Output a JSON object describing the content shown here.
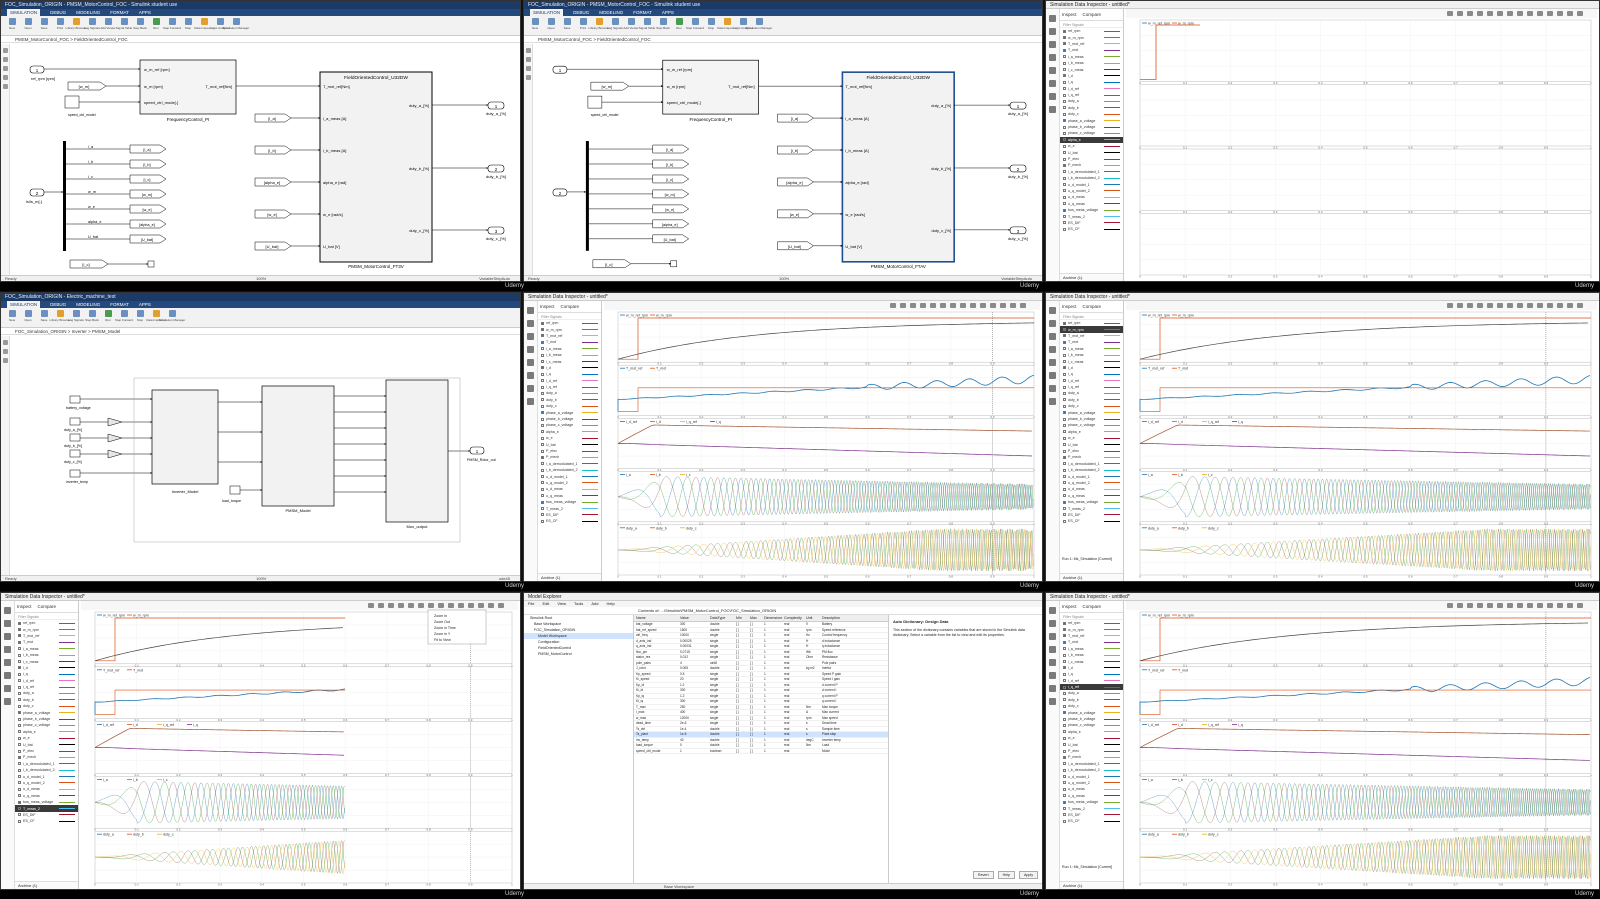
{
  "watermark": "Udemy",
  "simulink_fotw": {
    "title": "FOC_Simulation_ORIGIN - PMSM_MotorControl_FOC - Simulink student use",
    "tabs": [
      "SIMULATION",
      "DEBUG",
      "MODELING",
      "FORMAT",
      "APPS"
    ],
    "ribbon": [
      "New",
      "Open",
      "Save",
      "Print",
      "Library Browser",
      "Log Signals",
      "Add Viewer",
      "Signal Table",
      "Step Back",
      "Run",
      "Step Forward",
      "Stop",
      "Data Inspector",
      "Logic Analyzer",
      "Simulation Manager"
    ],
    "address": "PMSM_MotorControl_FOC > FieldOrientedControl_FOC",
    "blocks": {
      "freq_ctrl": "FrequencyControl_PI",
      "foc": "FieldOrientedControl_U32DW",
      "pmsm": "PMSM_MotorControl_FT3V",
      "pmsm_right": "PMSM_MotorControl_FTAV",
      "speed_ctrl": "speed_ctrl_model"
    },
    "in_ports": [
      "ref_rpm [rpm]",
      "ls/ls_m[-]"
    ],
    "freq_ports_in": [
      "w_m_ref [rpm]",
      "w_m [rpm]",
      "speed_ctrl_mode[-]"
    ],
    "freq_ports_out": "T_mot_ref[Nm]",
    "foc_ports_in": [
      "T_mot_ref[Nm]",
      "i_a_meas [A]",
      "i_b_meas [A]",
      "alpha_e [rad]",
      "w_e [rad/s]",
      "U_bat [V]"
    ],
    "foc_ports_out": [
      "duty_a_[%]",
      "duty_b_[%]",
      "duty_c_[%]"
    ],
    "out_ports": [
      "duty_a_[%]",
      "duty_b_[%]",
      "duty_c_[%]"
    ],
    "goto_tags": [
      "[i_a]",
      "[i_b]",
      "[alpha_e]",
      "[w_e]",
      "[U_bat]"
    ],
    "mux_tags": [
      "[i_a]",
      "[i_b]",
      "[i_c]",
      "[w_m]",
      "[w_e]",
      "[alpha_e]",
      "[U_bat]"
    ],
    "mux_labels": [
      "i_a",
      "i_b",
      "i_c",
      "w_m",
      "w_e",
      "alpha_e",
      "U_bat"
    ],
    "from_tag": "[i_c]",
    "status_left": "Ready",
    "status_mid": "100%",
    "status_right": "VariableStepAuto"
  },
  "simulink_plant": {
    "title": "FOC_Simulation_ORIGIN - Electric_machine_test",
    "address": "FOC_Simulation_ORIGIN > Inverter > PMSM_Model",
    "blocks": [
      "Inverter_Model",
      "PMSM_Model",
      "Mux_output"
    ],
    "inputs": [
      "battery_voltage",
      "duty_a_[%]",
      "duty_b_[%]",
      "duty_c_[%]",
      "inverter_temp"
    ],
    "load_torque": "load_torque",
    "pmsm_out_port": "PMSM_Rotor_out",
    "status_mid": "100%",
    "status_right": "ode45"
  },
  "data_inspector": {
    "title": "Simulation Data Inspector - untitled*",
    "tabs": [
      "Inspect",
      "Compare"
    ],
    "filter": "Filter Signals",
    "signals": [
      "ref_rpm",
      "w_m_rpm",
      "T_mot_ref",
      "T_mot",
      "i_a_meas",
      "i_b_meas",
      "i_c_meas",
      "i_d",
      "i_q",
      "i_d_ref",
      "i_q_ref",
      "duty_a",
      "duty_b",
      "duty_c",
      "phase_a_voltage",
      "phase_b_voltage",
      "phase_c_voltage",
      "alpha_e",
      "w_e",
      "U_bat",
      "P_elec",
      "P_mech",
      "i_a_demodulated_1",
      "i_b_demodulated_2",
      "u_d_model_1",
      "u_q_model_2",
      "u_d_meas",
      "u_q_meas",
      "bus_meas_voltage",
      "T_meas_2",
      "ES_DIF",
      "ES_CF"
    ],
    "footer": "Archive (1)",
    "properties": "Properties",
    "run_label": "Run 1: Mk_Simulation [Current]",
    "plot_titles": [
      [
        "w_m_ref_rpm",
        "w_m_rpm"
      ],
      [
        "T_mot_ref",
        "T_mot"
      ],
      [
        "i_d_ref",
        "i_d",
        "i_q_ref",
        "i_q"
      ],
      [
        "i_a",
        "i_b",
        "i_c"
      ],
      [
        "duty_a",
        "duty_b",
        "duty_c"
      ]
    ],
    "time_ticks": [
      "0",
      "0.1",
      "0.2",
      "0.3",
      "0.4",
      "0.5",
      "0.6",
      "0.7",
      "0.8",
      "0.9",
      "1"
    ],
    "menu_items": [
      "Zoom In",
      "Zoom Out",
      "Zoom in Time",
      "Zoom in Y",
      "Fit to View"
    ]
  },
  "model_explorer": {
    "title": "Model Explorer",
    "menu": [
      "File",
      "Edit",
      "View",
      "Tools",
      "Add",
      "Help"
    ],
    "path": "Contents of: ...\\Simulink\\PMSM_MotorControl_FOC\\FOC_Simulation_ORIGIN",
    "tree": [
      "Simulink Root",
      "Base Workspace",
      "FOC_Simulation_ORIGIN",
      "Model Workspace",
      "Configuration",
      "FieldOrientedControl",
      "PMSM_MotorControl"
    ],
    "columns": [
      "Name",
      "Value",
      "DataType",
      "Min",
      "Max",
      "Dimensions",
      "Complexity",
      "Unit",
      "Description"
    ],
    "rows": [
      [
        "bat_voltage",
        "300",
        "double",
        "[ ]",
        "[ ]",
        "1",
        "real",
        "V",
        "Battery"
      ],
      [
        "bat_ref_speed",
        "1500",
        "double",
        "[ ]",
        "[ ]",
        "1",
        "real",
        "rpm",
        "Speed reference"
      ],
      [
        "ctrl_freq",
        "10000",
        "single",
        "[ ]",
        "[ ]",
        "1",
        "real",
        "Hz",
        "Control frequency"
      ],
      [
        "d_axis_ind",
        "0.00025",
        "single",
        "[ ]",
        "[ ]",
        "1",
        "real",
        "H",
        "d inductance"
      ],
      [
        "q_axis_ind",
        "0.00031",
        "single",
        "[ ]",
        "[ ]",
        "1",
        "real",
        "H",
        "q inductance"
      ],
      [
        "flux_pm",
        "0.0715",
        "single",
        "[ ]",
        "[ ]",
        "1",
        "real",
        "Wb",
        "PM flux"
      ],
      [
        "stator_res",
        "0.012",
        "single",
        "[ ]",
        "[ ]",
        "1",
        "real",
        "Ohm",
        "Resistance"
      ],
      [
        "pole_pairs",
        "4",
        "uint8",
        "[ ]",
        "[ ]",
        "1",
        "real",
        "",
        "Pole pairs"
      ],
      [
        "J_rotor",
        "0.005",
        "double",
        "[ ]",
        "[ ]",
        "1",
        "real",
        "kg m2",
        "Inertia"
      ],
      [
        "Kp_speed",
        "0.5",
        "single",
        "[ ]",
        "[ ]",
        "1",
        "real",
        "",
        "Speed P gain"
      ],
      [
        "Ki_speed",
        "20",
        "single",
        "[ ]",
        "[ ]",
        "1",
        "real",
        "",
        "Speed I gain"
      ],
      [
        "Kp_id",
        "1.2",
        "single",
        "[ ]",
        "[ ]",
        "1",
        "real",
        "",
        "d current P"
      ],
      [
        "Ki_id",
        "300",
        "single",
        "[ ]",
        "[ ]",
        "1",
        "real",
        "",
        "d current I"
      ],
      [
        "Kp_iq",
        "1.2",
        "single",
        "[ ]",
        "[ ]",
        "1",
        "real",
        "",
        "q current P"
      ],
      [
        "Ki_iq",
        "300",
        "single",
        "[ ]",
        "[ ]",
        "1",
        "real",
        "",
        "q current I"
      ],
      [
        "T_max",
        "250",
        "single",
        "[ ]",
        "[ ]",
        "1",
        "real",
        "Nm",
        "Max torque"
      ],
      [
        "i_max",
        "400",
        "single",
        "[ ]",
        "[ ]",
        "1",
        "real",
        "A",
        "Max current"
      ],
      [
        "w_max",
        "12000",
        "single",
        "[ ]",
        "[ ]",
        "1",
        "real",
        "rpm",
        "Max speed"
      ],
      [
        "dead_time",
        "2e-6",
        "single",
        "[ ]",
        "[ ]",
        "1",
        "real",
        "s",
        "Dead time"
      ],
      [
        "Ts_ctrl",
        "1e-4",
        "double",
        "[ ]",
        "[ ]",
        "1",
        "real",
        "s",
        "Sample time"
      ],
      [
        "Ts_plant",
        "1e-6",
        "double",
        "[ ]",
        "[ ]",
        "1",
        "real",
        "s",
        "Plant step"
      ],
      [
        "inv_temp",
        "40",
        "double",
        "[ ]",
        "[ ]",
        "1",
        "real",
        "degC",
        "Inverter temp"
      ],
      [
        "load_torque",
        "0",
        "double",
        "[ ]",
        "[ ]",
        "1",
        "real",
        "Nm",
        "Load"
      ],
      [
        "speed_ctrl_mode",
        "1",
        "boolean",
        "[ ]",
        "[ ]",
        "1",
        "real",
        "",
        "Mode"
      ]
    ],
    "pane_title": "Auto Dictionary: Design Data",
    "pane_text": "This section of the dictionary contains variables that are stored in the Simulink data dictionary. Select a variable from the list to view and edit its properties.",
    "buttons": [
      "Revert",
      "Help",
      "Apply"
    ],
    "status": "Base Workspace"
  }
}
